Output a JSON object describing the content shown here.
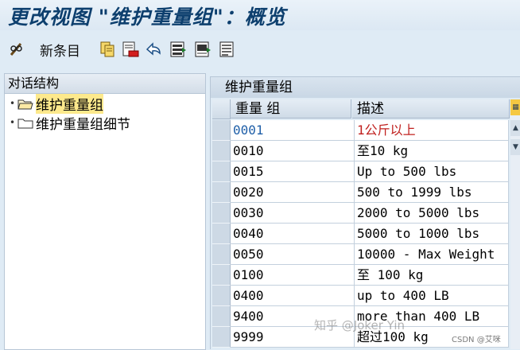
{
  "window": {
    "title": "更改视图 \"维护重量组\"：概览"
  },
  "toolbar": {
    "new_entries_label": "新条目",
    "icons": [
      "pencil-glasses-icon",
      "copy-icon",
      "delete-icon",
      "undo-icon",
      "select-all-icon",
      "select-block-icon",
      "deselect-all-icon"
    ]
  },
  "dialog_structure": {
    "header": "对话结构",
    "items": [
      {
        "label": "维护重量组",
        "selected": true
      },
      {
        "label": "维护重量组细节",
        "selected": false
      }
    ]
  },
  "table": {
    "caption": "维护重量组",
    "columns": [
      "重量 组",
      "描述"
    ],
    "rows": [
      {
        "code": "0001",
        "desc": "1公斤以上"
      },
      {
        "code": "0010",
        "desc": "至10 kg"
      },
      {
        "code": "0015",
        "desc": "Up to 500 lbs"
      },
      {
        "code": "0020",
        "desc": "500 to 1999 lbs"
      },
      {
        "code": "0030",
        "desc": "2000 to 5000 lbs"
      },
      {
        "code": "0040",
        "desc": "5000 to 1000 lbs"
      },
      {
        "code": "0050",
        "desc": "10000 - Max Weight"
      },
      {
        "code": "0100",
        "desc": "至 100 kg"
      },
      {
        "code": "0400",
        "desc": "up to 400 LB"
      },
      {
        "code": "9400",
        "desc": "more than 400 LB"
      },
      {
        "code": "9999",
        "desc": "超过100 kg"
      }
    ]
  },
  "watermark": {
    "text": "知乎 @Joker Yin",
    "source": "CSDN @艾咪"
  },
  "colors": {
    "first_code": "#1f5fa8",
    "first_desc": "#c0201e",
    "title": "#0d3f6e"
  }
}
